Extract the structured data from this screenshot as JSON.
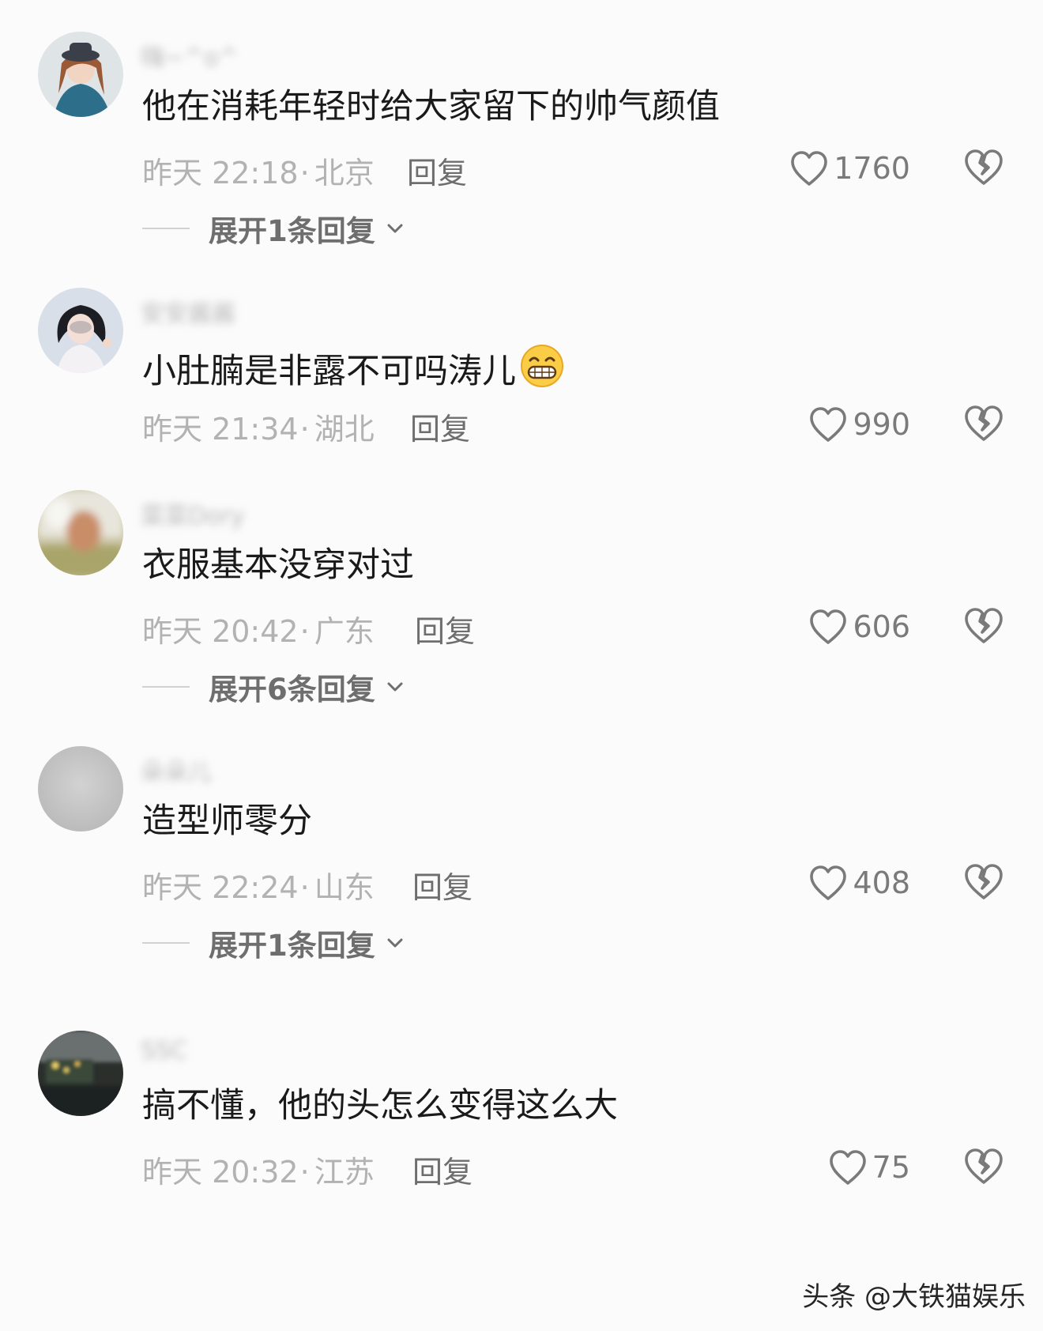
{
  "comments": [
    {
      "username": "嗨~^o^",
      "text": "他在消耗年轻时给大家留下的帅气颜值",
      "time": "昨天 22:18",
      "location": "北京",
      "reply_label": "回复",
      "likes": "1760",
      "expand_label": "展开1条回复"
    },
    {
      "username": "安安酱酱",
      "text": "小肚腩是非露不可吗涛儿",
      "time": "昨天 21:34",
      "location": "湖北",
      "reply_label": "回复",
      "likes": "990",
      "expand_label": ""
    },
    {
      "username": "菜菜Dory",
      "text": "衣服基本没穿对过",
      "time": "昨天 20:42",
      "location": "广东",
      "reply_label": "回复",
      "likes": "606",
      "expand_label": "展开6条回复"
    },
    {
      "username": "朵朵儿",
      "text": "造型师零分",
      "time": "昨天 22:24",
      "location": "山东",
      "reply_label": "回复",
      "likes": "408",
      "expand_label": "展开1条回复"
    },
    {
      "username": "SSC",
      "text": "搞不懂，他的头怎么变得这么大",
      "time": "昨天 20:32",
      "location": "江苏",
      "reply_label": "回复",
      "likes": "75",
      "expand_label": ""
    }
  ],
  "watermark": "头条 @大铁猫娱乐",
  "icons": {
    "like": "heart-outline-icon",
    "dislike": "broken-heart-icon",
    "expand": "chevron-down-icon",
    "emoji": "grinning-emoji-icon"
  }
}
